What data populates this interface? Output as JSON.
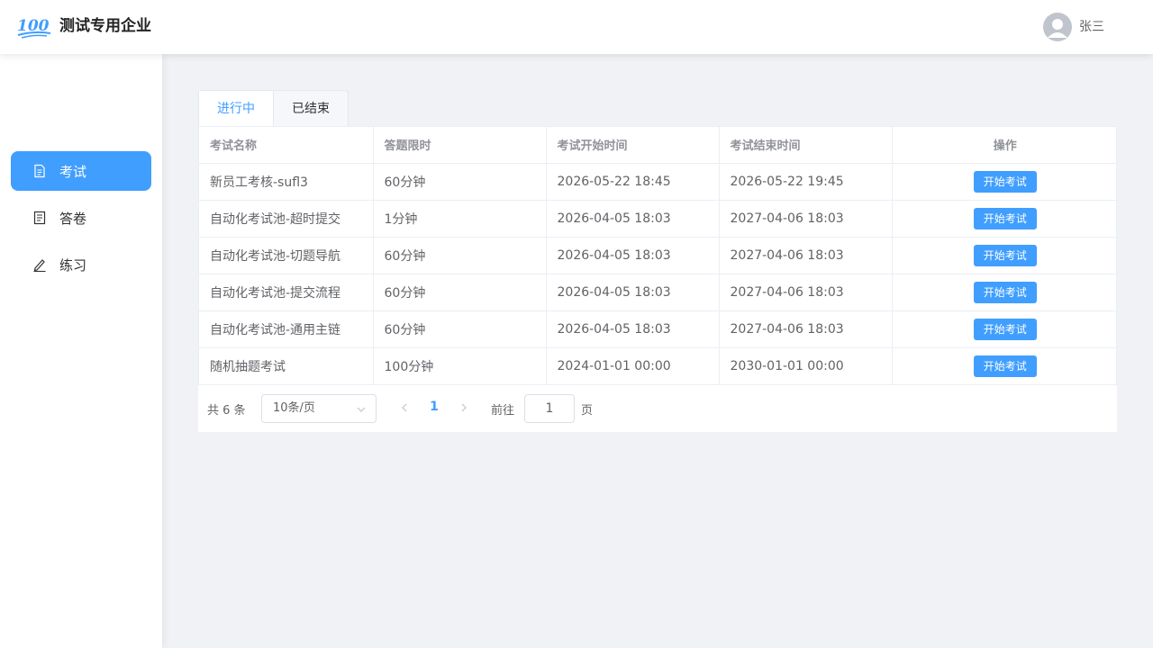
{
  "header": {
    "logo_text": "100",
    "company": "测试专用企业",
    "username": "张三"
  },
  "sidebar": {
    "items": [
      {
        "label": "考试",
        "icon": "document-icon",
        "active": true
      },
      {
        "label": "答卷",
        "icon": "answer-sheet-icon",
        "active": false
      },
      {
        "label": "练习",
        "icon": "pen-icon",
        "active": false
      }
    ]
  },
  "tabs": [
    {
      "label": "进行中",
      "active": true
    },
    {
      "label": "已结束",
      "active": false
    }
  ],
  "table": {
    "columns": [
      "考试名称",
      "答题限时",
      "考试开始时间",
      "考试结束时间",
      "操作"
    ],
    "action_label": "开始考试",
    "rows": [
      [
        "新员工考核-sufl3",
        "60分钟",
        "2026-05-22 18:45",
        "2026-05-22 19:45"
      ],
      [
        "自动化考试池-超时提交",
        "1分钟",
        "2026-04-05 18:03",
        "2027-04-06 18:03"
      ],
      [
        "自动化考试池-切题导航",
        "60分钟",
        "2026-04-05 18:03",
        "2027-04-06 18:03"
      ],
      [
        "自动化考试池-提交流程",
        "60分钟",
        "2026-04-05 18:03",
        "2027-04-06 18:03"
      ],
      [
        "自动化考试池-通用主链",
        "60分钟",
        "2026-04-05 18:03",
        "2027-04-06 18:03"
      ],
      [
        "随机抽题考试",
        "100分钟",
        "2024-01-01 00:00",
        "2030-01-01 00:00"
      ]
    ]
  },
  "pagination": {
    "total_label": "共 6 条",
    "page_size": "10条/页",
    "current_page": "1",
    "goto_label": "前往",
    "goto_value": "1",
    "page_unit": "页"
  },
  "colors": {
    "accent": "#409eff",
    "background": "#f0f2f5"
  }
}
